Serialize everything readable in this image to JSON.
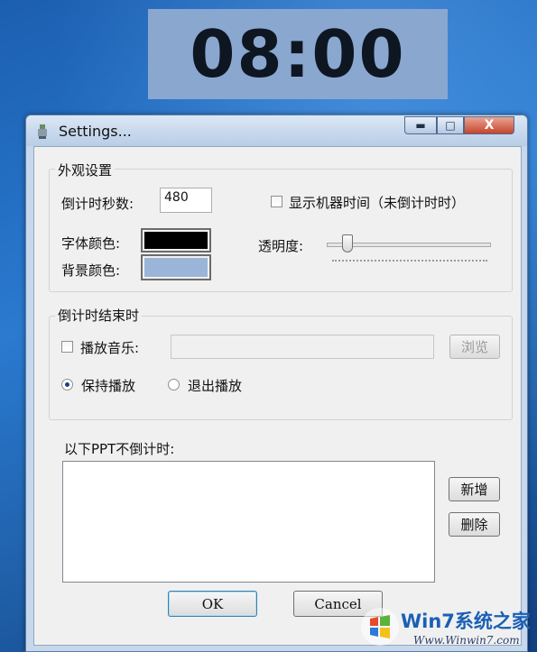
{
  "clock": {
    "time": "08:00"
  },
  "window": {
    "title": "Settings...",
    "controls": {
      "minimize": "▬",
      "maximize": "□",
      "close": "X"
    }
  },
  "appearance": {
    "legend": "外观设置",
    "seconds_label": "倒计时秒数:",
    "seconds_value": "480",
    "show_machine_time_label": "显示机器时间（未倒计时时）",
    "show_machine_time_checked": false,
    "font_color_label": "字体颜色:",
    "font_color": "#000000",
    "bg_color_label": "背景颜色:",
    "bg_color": "#9bb5d8",
    "opacity_label": "透明度:",
    "opacity_fraction": 0.1
  },
  "on_end": {
    "legend": "倒计时结束时",
    "play_music_label": "播放音乐:",
    "play_music_checked": false,
    "music_path": "",
    "browse_label": "浏览",
    "keep_playing_label": "保持播放",
    "exit_playing_label": "退出播放",
    "selected_option": "keep_playing"
  },
  "ppt": {
    "list_label": "以下PPT不倒计时:",
    "items": [],
    "add_label": "新增",
    "delete_label": "删除"
  },
  "footer": {
    "ok_label": "OK",
    "cancel_label": "Cancel"
  },
  "watermark": {
    "brand": "Win7系统之家",
    "url": "Www.Winwin7.com"
  },
  "colors": {
    "desktop_blue": "#1f66b8",
    "window_frame": "#c7d8ec",
    "close_red": "#c6442c"
  }
}
